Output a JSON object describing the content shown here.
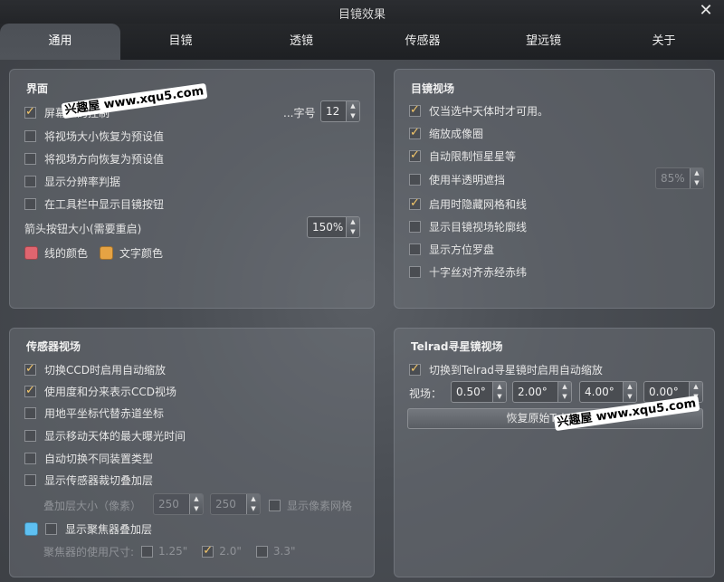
{
  "window": {
    "title": "目镜效果"
  },
  "tabs": [
    "通用",
    "目镜",
    "透镜",
    "传感器",
    "望远镜",
    "关于"
  ],
  "interface_panel": {
    "title": "界面",
    "items": [
      {
        "label": "屏幕上的控制",
        "checked": true
      },
      {
        "label": "将视场大小恢复为预设值",
        "checked": false
      },
      {
        "label": "将视场方向恢复为预设值",
        "checked": false
      },
      {
        "label": "显示分辨率判据",
        "checked": false
      },
      {
        "label": "在工具栏中显示目镜按钮",
        "checked": false
      }
    ],
    "font_size_label": "...字号",
    "font_size_value": "12",
    "arrow_size_label": "箭头按钮大小(需要重启)",
    "arrow_size_value": "150%",
    "line_color_label": "线的颜色",
    "text_color_label": "文字颜色",
    "line_color": "#e0656f",
    "text_color": "#e6a343"
  },
  "eyepiece_panel": {
    "title": "目镜视场",
    "items": [
      {
        "label": "仅当选中天体时才可用。",
        "checked": true
      },
      {
        "label": "缩放成像圈",
        "checked": true
      },
      {
        "label": "自动限制恒星星等",
        "checked": true
      },
      {
        "label": "使用半透明遮挡",
        "checked": false
      },
      {
        "label": "启用时隐藏网格和线",
        "checked": true
      },
      {
        "label": "显示目镜视场轮廓线",
        "checked": false
      },
      {
        "label": "显示方位罗盘",
        "checked": false
      },
      {
        "label": "十字丝对齐赤经赤纬",
        "checked": false
      }
    ],
    "opacity_value": "85%"
  },
  "sensor_panel": {
    "title": "传感器视场",
    "items": [
      {
        "label": "切换CCD时启用自动缩放",
        "checked": true
      },
      {
        "label": "使用度和分来表示CCD视场",
        "checked": true
      },
      {
        "label": "用地平坐标代替赤道坐标",
        "checked": false
      },
      {
        "label": "显示移动天体的最大曝光时间",
        "checked": false
      },
      {
        "label": "自动切换不同装置类型",
        "checked": false
      },
      {
        "label": "显示传感器裁切叠加层",
        "checked": false
      }
    ],
    "overlay_size_label": "叠加层大小（像素）",
    "overlay_w": "250",
    "overlay_h": "250",
    "pixel_grid_label": "显示像素网格",
    "focuser_label": "显示聚焦器叠加层",
    "focuser_color": "#5ec0f2",
    "focuser_sizes_label": "聚焦器的使用尺寸:",
    "focuser_sizes": [
      {
        "label": "1.25\"",
        "checked": false
      },
      {
        "label": "2.0\"",
        "checked": true
      },
      {
        "label": "3.3\"",
        "checked": false
      }
    ]
  },
  "telrad_panel": {
    "title": "Telrad寻星镜视场",
    "autozoom_label": "切换到Telrad寻星镜时启用自动缩放",
    "autozoom_checked": true,
    "fov_label": "视场：",
    "fov_values": [
      "0.50°",
      "2.00°",
      "4.00°",
      "0.00°"
    ],
    "reset_label": "恢复原始Telrad视场"
  },
  "watermark": "兴趣屋 www.xqu5.com"
}
